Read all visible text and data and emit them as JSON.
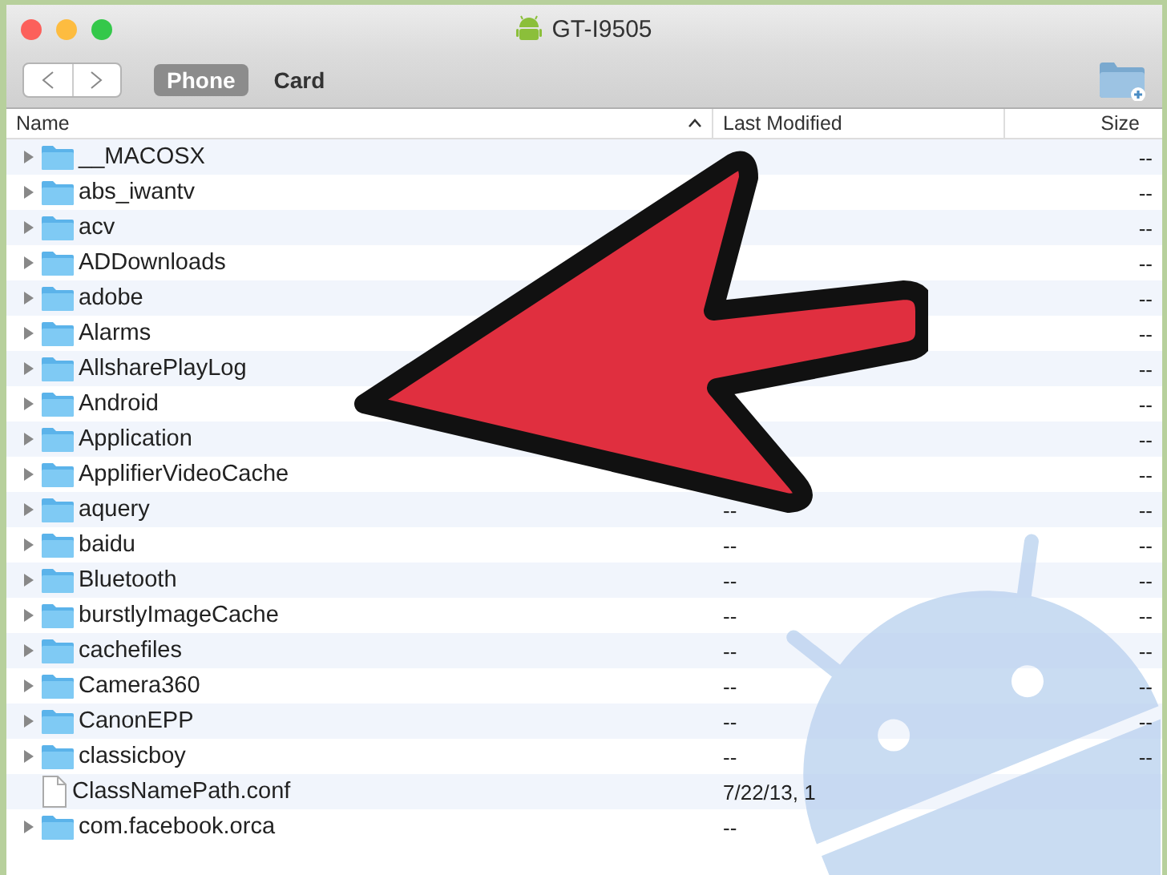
{
  "window": {
    "title": "GT-I9505"
  },
  "tabs": [
    {
      "label": "Phone",
      "selected": true
    },
    {
      "label": "Card",
      "selected": false
    }
  ],
  "table": {
    "columns": [
      {
        "label": "Name",
        "sorted": true
      },
      {
        "label": "Last Modified",
        "sorted": false
      },
      {
        "label": "Size",
        "sorted": false
      }
    ],
    "rows": [
      {
        "kind": "folder",
        "name": "__MACOSX",
        "expanded": false,
        "size": "--"
      },
      {
        "kind": "folder",
        "name": "abs_iwantv",
        "expanded": false,
        "size": "--"
      },
      {
        "kind": "folder",
        "name": "acv",
        "expanded": false,
        "size": "--"
      },
      {
        "kind": "folder",
        "name": "ADDownloads",
        "expanded": false,
        "size": "--"
      },
      {
        "kind": "folder",
        "name": "adobe",
        "expanded": false,
        "size": "--"
      },
      {
        "kind": "folder",
        "name": "Alarms",
        "expanded": false,
        "size": "--"
      },
      {
        "kind": "folder",
        "name": "AllsharePlayLog",
        "expanded": false,
        "size": "--"
      },
      {
        "kind": "folder",
        "name": "Android",
        "expanded": false,
        "size": "--"
      },
      {
        "kind": "folder",
        "name": "Application",
        "expanded": false,
        "size": "--"
      },
      {
        "kind": "folder",
        "name": "ApplifierVideoCache",
        "expanded": false,
        "size": "--"
      },
      {
        "kind": "folder",
        "name": "aquery",
        "expanded": false,
        "modified": "--",
        "size": "--"
      },
      {
        "kind": "folder",
        "name": "baidu",
        "expanded": false,
        "modified": "--",
        "size": "--"
      },
      {
        "kind": "folder",
        "name": "Bluetooth",
        "expanded": false,
        "modified": "--",
        "size": "--"
      },
      {
        "kind": "folder",
        "name": "burstlyImageCache",
        "expanded": false,
        "modified": "--",
        "size": "--"
      },
      {
        "kind": "folder",
        "name": "cachefiles",
        "expanded": false,
        "modified": "--",
        "size": "--"
      },
      {
        "kind": "folder",
        "name": "Camera360",
        "expanded": false,
        "modified": "--",
        "size": "--"
      },
      {
        "kind": "folder",
        "name": "CanonEPP",
        "expanded": false,
        "modified": "--",
        "size": "--"
      },
      {
        "kind": "folder",
        "name": "classicboy",
        "expanded": false,
        "modified": "--",
        "size": "--"
      },
      {
        "kind": "file",
        "name": "ClassNamePath.conf",
        "modified": "7/22/13, 1"
      },
      {
        "kind": "folder",
        "name": "com.facebook.orca",
        "expanded": false,
        "modified": "--"
      }
    ]
  }
}
